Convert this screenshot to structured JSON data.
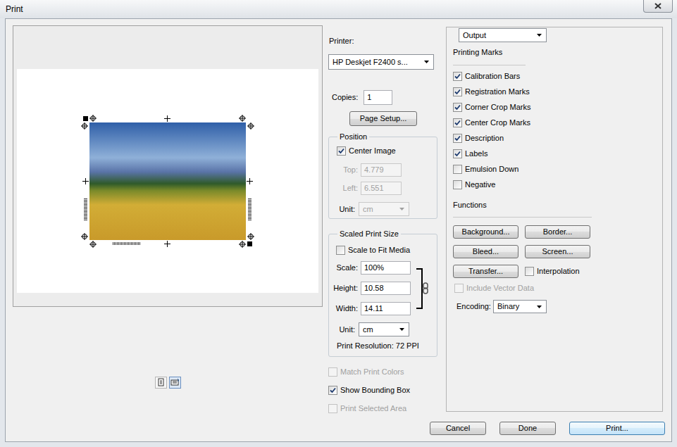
{
  "window": {
    "title": "Print"
  },
  "preview": {
    "orientations": [
      {
        "kind": "portrait",
        "selected": false
      },
      {
        "kind": "landscape",
        "selected": true
      }
    ]
  },
  "printer": {
    "label": "Printer:",
    "value": "HP Deskjet F2400 s..."
  },
  "copies": {
    "label": "Copies:",
    "value": "1"
  },
  "page_setup": "Page Setup...",
  "position": {
    "title": "Position",
    "center_image": {
      "label": "Center Image",
      "checked": true,
      "disabled": false
    },
    "fields": [
      {
        "label": "Top:",
        "value": "4.779",
        "disabled": true
      },
      {
        "label": "Left:",
        "value": "6.551",
        "disabled": true
      }
    ],
    "unit": {
      "label": "Unit:",
      "value": "cm",
      "disabled": true
    }
  },
  "scaled_print_size": {
    "title": "Scaled Print Size",
    "scale_to_fit": {
      "label": "Scale to Fit Media",
      "checked": false,
      "disabled": false
    },
    "fields": [
      {
        "label": "Scale:",
        "value": "100%",
        "disabled": false
      },
      {
        "label": "Height:",
        "value": "10.58",
        "disabled": false
      },
      {
        "label": "Width:",
        "value": "14.11",
        "disabled": false
      }
    ],
    "linked": true,
    "unit": {
      "label": "Unit:",
      "value": "cm",
      "disabled": false
    },
    "resolution": "Print Resolution: 72 PPI"
  },
  "options": [
    {
      "label": "Match Print Colors",
      "checked": false,
      "disabled": true
    },
    {
      "label": "Show Bounding Box",
      "checked": true,
      "disabled": false
    },
    {
      "label": "Print Selected Area",
      "checked": false,
      "disabled": true
    }
  ],
  "output": {
    "section": "Output",
    "printing_marks": {
      "title": "Printing Marks",
      "items": [
        {
          "label": "Calibration Bars",
          "checked": true,
          "disabled": false
        },
        {
          "label": "Registration Marks",
          "checked": true,
          "disabled": false
        },
        {
          "label": "Corner Crop Marks",
          "checked": true,
          "disabled": false
        },
        {
          "label": "Center Crop Marks",
          "checked": true,
          "disabled": false
        },
        {
          "label": "Description",
          "checked": true,
          "disabled": false
        },
        {
          "label": "Labels",
          "checked": true,
          "disabled": false
        },
        {
          "label": "Emulsion Down",
          "checked": false,
          "disabled": false
        },
        {
          "label": "Negative",
          "checked": false,
          "disabled": false
        }
      ]
    },
    "functions": {
      "title": "Functions",
      "buttons": [
        "Background...",
        "Border...",
        "Bleed...",
        "Screen...",
        "Transfer..."
      ],
      "interpolation": {
        "label": "Interpolation",
        "checked": false,
        "disabled": false
      },
      "include_vector_data": {
        "label": "Include Vector Data",
        "checked": false,
        "disabled": true
      },
      "encoding": {
        "label": "Encoding:",
        "value": "Binary"
      }
    }
  },
  "buttons": [
    {
      "label": "Cancel",
      "default": false
    },
    {
      "label": "Done",
      "default": false
    },
    {
      "label": "Print...",
      "default": true
    }
  ]
}
